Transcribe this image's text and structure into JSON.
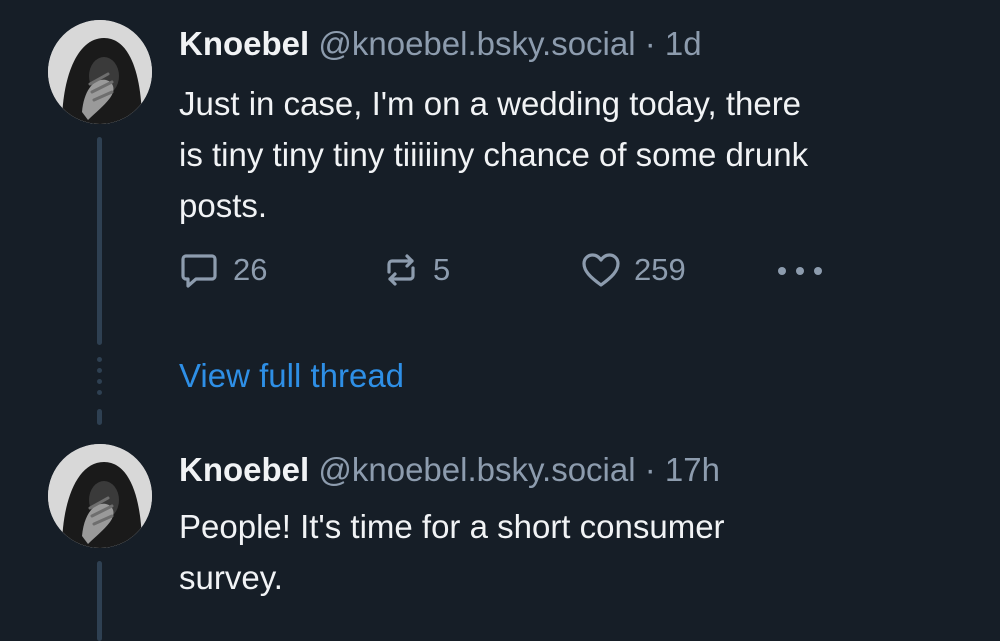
{
  "posts": [
    {
      "author_name": "Knoebel",
      "author_handle": "@knoebel.bsky.social",
      "separator": "·",
      "time": "1d",
      "text": "Just in case, I'm on a wedding today, there\nis tiny tiny tiny tiiiiiny chance of some drunk\nposts.",
      "replies": "26",
      "reposts": "5",
      "likes": "259",
      "icons": {
        "avatar": "avatar-hooded-figure-icon",
        "reply": "speech-bubble-icon",
        "repost": "repost-arrows-icon",
        "like": "heart-icon",
        "more": "more-dots-icon"
      }
    },
    {
      "author_name": "Knoebel",
      "author_handle": "@knoebel.bsky.social",
      "separator": "·",
      "time": "17h",
      "text": "People! It's time for a short consumer\nsurvey.",
      "icons": {
        "avatar": "avatar-hooded-figure-icon"
      }
    }
  ],
  "thread": {
    "view_full_thread": "View full thread"
  },
  "colors": {
    "background": "#161e27",
    "text_primary": "#f1f3f5",
    "text_secondary": "#8d9cae",
    "link": "#2e8fe6",
    "thread_line": "#2e4052"
  }
}
